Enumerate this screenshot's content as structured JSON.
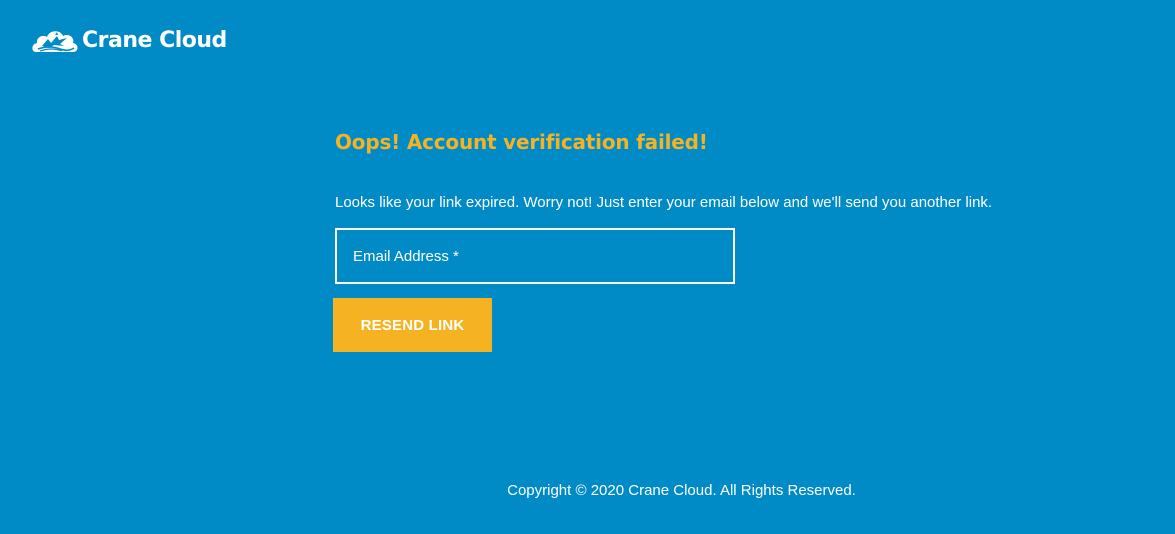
{
  "brand": {
    "name": "Crane Cloud",
    "logo_icon": "crane-cloud-icon"
  },
  "verification": {
    "title": "Oops! Account verification failed!",
    "message": "Looks like your link expired. Worry not! Just enter your email below and we'll send you another link.",
    "email_placeholder": "Email Address *",
    "email_value": "",
    "resend_label": "RESEND LINK"
  },
  "footer": {
    "copyright": "Copyright © 2020 Crane Cloud. All Rights Reserved."
  },
  "colors": {
    "background": "#008AC6",
    "accent": "#F5B323",
    "text": "#FFFFFF"
  }
}
